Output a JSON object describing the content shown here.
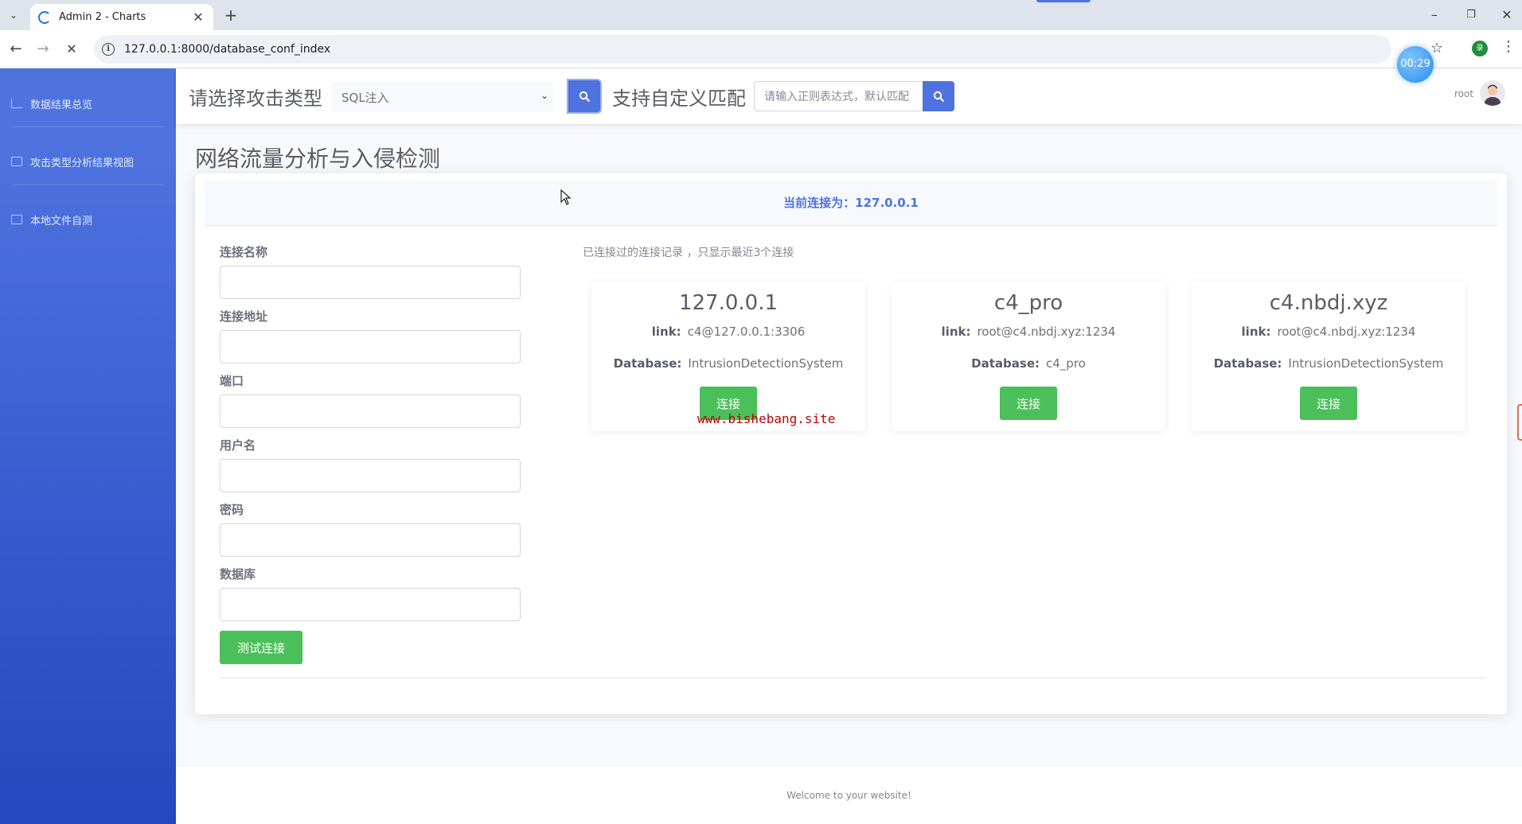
{
  "browser": {
    "tab_title": "Admin 2 - Charts",
    "url": "127.0.0.1:8000/database_conf_index",
    "timer": "00:29",
    "profile_initial": "录"
  },
  "sidebar": {
    "items": [
      {
        "label": "数据结果总览",
        "icon": "chart-area-icon"
      },
      {
        "label": "攻击类型分析结果视图",
        "icon": "table-icon"
      },
      {
        "label": "本地文件自测",
        "icon": "table-icon"
      }
    ]
  },
  "topbar": {
    "attack_type_label": "请选择攻击类型",
    "attack_type_selected": "SQL注入",
    "custom_match_label": "支持自定义匹配",
    "regex_placeholder": "请输入正则表达式，默认匹配",
    "user_name": "root"
  },
  "main": {
    "page_title": "网络流量分析与入侵检测",
    "current_connection": "当前连接为：127.0.0.1",
    "form": {
      "fields": [
        {
          "label": "连接名称",
          "value": ""
        },
        {
          "label": "连接地址",
          "value": ""
        },
        {
          "label": "端口",
          "value": ""
        },
        {
          "label": "用户名",
          "value": ""
        },
        {
          "label": "密码",
          "value": ""
        },
        {
          "label": "数据库",
          "value": ""
        }
      ],
      "test_button": "测试连接"
    },
    "history_note": "已连接过的连接记录 ，只显示最近3个连接",
    "connections": [
      {
        "name": "127.0.0.1",
        "link_label": "link:",
        "link": "c4@127.0.0.1:3306",
        "db_label": "Database:",
        "database": "IntrusionDetectionSystem",
        "button": "连接"
      },
      {
        "name": "c4_pro",
        "link_label": "link:",
        "link": "root@c4.nbdj.xyz:1234",
        "db_label": "Database:",
        "database": "c4_pro",
        "button": "连接"
      },
      {
        "name": "c4.nbdj.xyz",
        "link_label": "link:",
        "link": "root@c4.nbdj.xyz:1234",
        "db_label": "Database:",
        "database": "IntrusionDetectionSystem",
        "button": "连接"
      }
    ]
  },
  "watermark": "www.bishebang.site",
  "footer": {
    "text": "Welcome to your website!"
  },
  "colors": {
    "primary": "#4e73df",
    "success": "#4bbf5a",
    "sidebar_dark": "#224abe"
  }
}
